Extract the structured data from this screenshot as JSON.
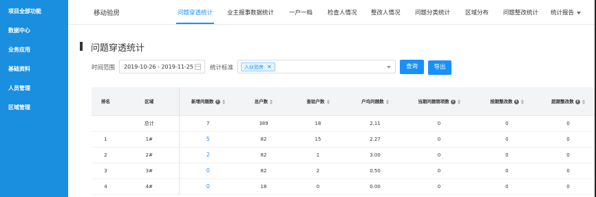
{
  "sidebar": {
    "items": [
      {
        "label": "项目全部功能"
      },
      {
        "label": "数据中心"
      },
      {
        "label": "业务应用"
      },
      {
        "label": "基础资料"
      },
      {
        "label": "人员管理"
      },
      {
        "label": "区域管理"
      }
    ]
  },
  "header": {
    "app_title": "移动验房",
    "nav": [
      {
        "label": "问题穿透统计",
        "active": true
      },
      {
        "label": "业主报事数据统计"
      },
      {
        "label": "一户一档"
      },
      {
        "label": "检查人情况"
      },
      {
        "label": "整改人情况"
      },
      {
        "label": "问题分类统计"
      },
      {
        "label": "区域分布"
      },
      {
        "label": "问题整改统计"
      },
      {
        "label": "统计报告"
      }
    ]
  },
  "page": {
    "title": "问题穿透统计"
  },
  "filters": {
    "time_range_label": "时间范围",
    "date_range_value": "2019-10-26 - 2019-11-25",
    "standard_label": "统计标准",
    "selected_tag": "入伙验房",
    "tag_close": "✕",
    "query_label": "查询",
    "export_label": "导出"
  },
  "table": {
    "columns": [
      "排名",
      "区域",
      "新增问题数",
      "总户数",
      "查验户数",
      "户均问题数",
      "当期问题销项数",
      "按期整改数",
      "超期整改数"
    ],
    "info_glyph": "i",
    "rows": [
      [
        "",
        "总计",
        "7",
        "389",
        "18",
        "2.11",
        "0",
        "0",
        "0"
      ],
      [
        "1",
        "1#",
        "5",
        "82",
        "15",
        "2.27",
        "0",
        "0",
        "0"
      ],
      [
        "2",
        "2#",
        "2",
        "82",
        "1",
        "3.00",
        "0",
        "0",
        "0"
      ],
      [
        "3",
        "3#",
        "0",
        "82",
        "2",
        "0.50",
        "0",
        "0",
        "0"
      ],
      [
        "4",
        "4#",
        "0",
        "18",
        "0",
        "0.00",
        "0",
        "0",
        "0"
      ]
    ]
  },
  "colors": {
    "sidebar": "#1a8fe0",
    "accent": "#1890ff"
  }
}
